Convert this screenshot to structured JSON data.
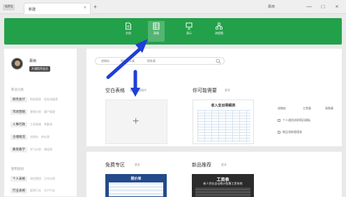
{
  "titlebar": {
    "logo": "WPS",
    "tab_label": "新建",
    "tab_close": "×",
    "tab_add": "+",
    "user": "慕雨",
    "min": "—",
    "max": "□",
    "close": "×"
  },
  "banner": {
    "items": [
      {
        "label": "文档",
        "icon": "document-icon"
      },
      {
        "label": "表格",
        "icon": "spreadsheet-icon",
        "active": true
      },
      {
        "label": "演示",
        "icon": "presentation-icon"
      },
      {
        "label": "流程图",
        "icon": "flowchart-icon"
      }
    ]
  },
  "profile": {
    "username": "慕雨",
    "vip_button": "开通稻壳会员"
  },
  "sidebar": {
    "occupation_title": "职业分类",
    "categories": [
      {
        "main": "财务会计",
        "subs": [
          "财务报表",
          "现金流量表"
        ]
      },
      {
        "main": "市场营销",
        "subs": [
          "营销计划",
          "客户管理"
        ]
      },
      {
        "main": "人事行政",
        "subs": [
          "工资表格",
          "考勤表"
        ]
      },
      {
        "main": "仓储物流",
        "subs": [
          "进销存",
          "库存表"
        ]
      },
      {
        "main": "教育教学",
        "subs": [
          "学习计划",
          "课程表"
        ]
      }
    ],
    "usage_title": "使用类别",
    "usages": [
      {
        "main": "个人表格",
        "subs": [
          "保险费用",
          "工作计划"
        ]
      },
      {
        "main": "行业表格",
        "subs": [
          "医院行业",
          "生产行业"
        ]
      }
    ]
  },
  "search": {
    "tags": [
      "进销存",
      "财务统计表",
      "财务表"
    ]
  },
  "blank": {
    "title": "空白表格",
    "tip": "查看快捷操作"
  },
  "recommend": {
    "title": "你可能需要",
    "more": "更多",
    "template_title": "收入支出明细表"
  },
  "keywords": [
    "进销存",
    "工资表",
    "采购表"
  ],
  "suggestions": [
    "个人通用求职简历模板",
    "物品领取管理表"
  ],
  "free": {
    "title": "免费专区",
    "more": "更多",
    "card_title": "报价单"
  },
  "new": {
    "title": "新品推荐",
    "more": "更多",
    "card_title": "工资表",
    "card_sub": "新人性化自动统计智算工资系统"
  },
  "colors": {
    "banner": "#23a04a",
    "arrow": "#1f3fd6",
    "dark_card": "#2b2b2b",
    "blue_card": "#234a8a"
  }
}
